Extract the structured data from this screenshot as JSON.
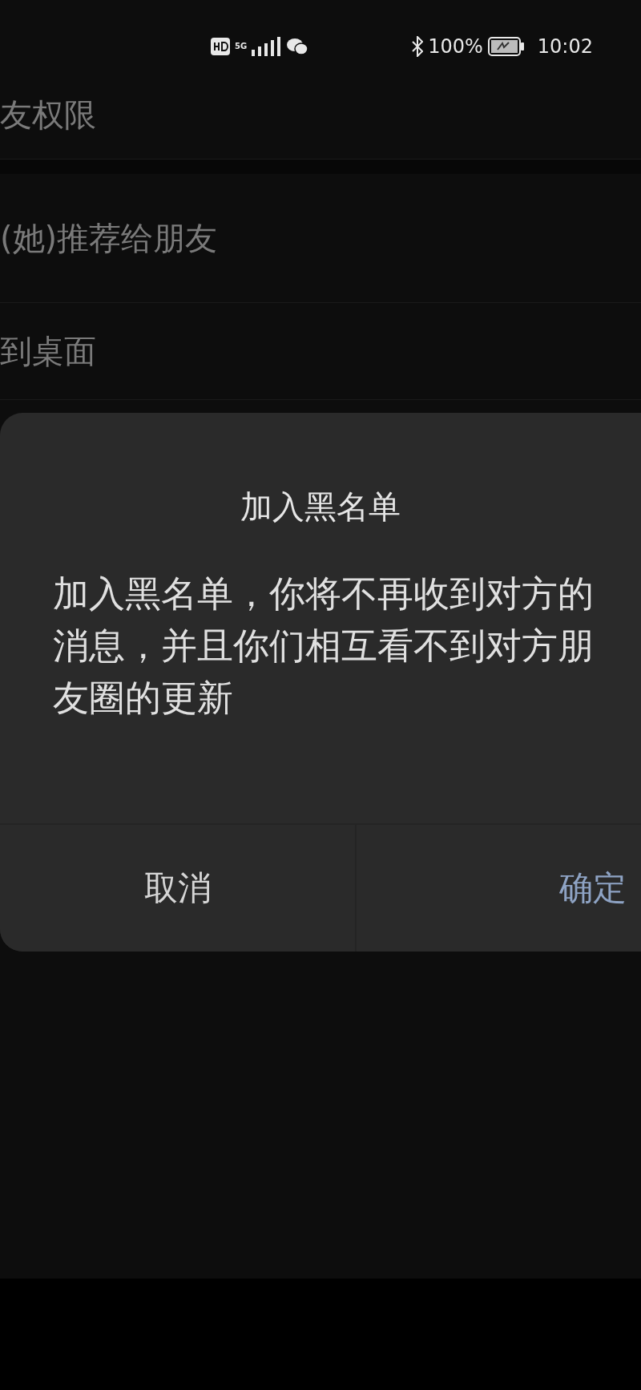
{
  "status_bar": {
    "network": "5G",
    "battery": "100%",
    "time": "10:02"
  },
  "settings_rows": [
    {
      "label": "友权限"
    },
    {
      "label": "(她)推荐给朋友"
    },
    {
      "label": "到桌面"
    }
  ],
  "dialog": {
    "title": "加入黑名单",
    "body_lines": [
      "加入黑名单，你将不再收到对方的",
      "消息，并且你们相互看不到对方朋",
      "友圈的更新"
    ],
    "buttons": [
      {
        "label": "取消",
        "kind": "cancel"
      },
      {
        "label": "确定",
        "kind": "confirm"
      }
    ]
  }
}
